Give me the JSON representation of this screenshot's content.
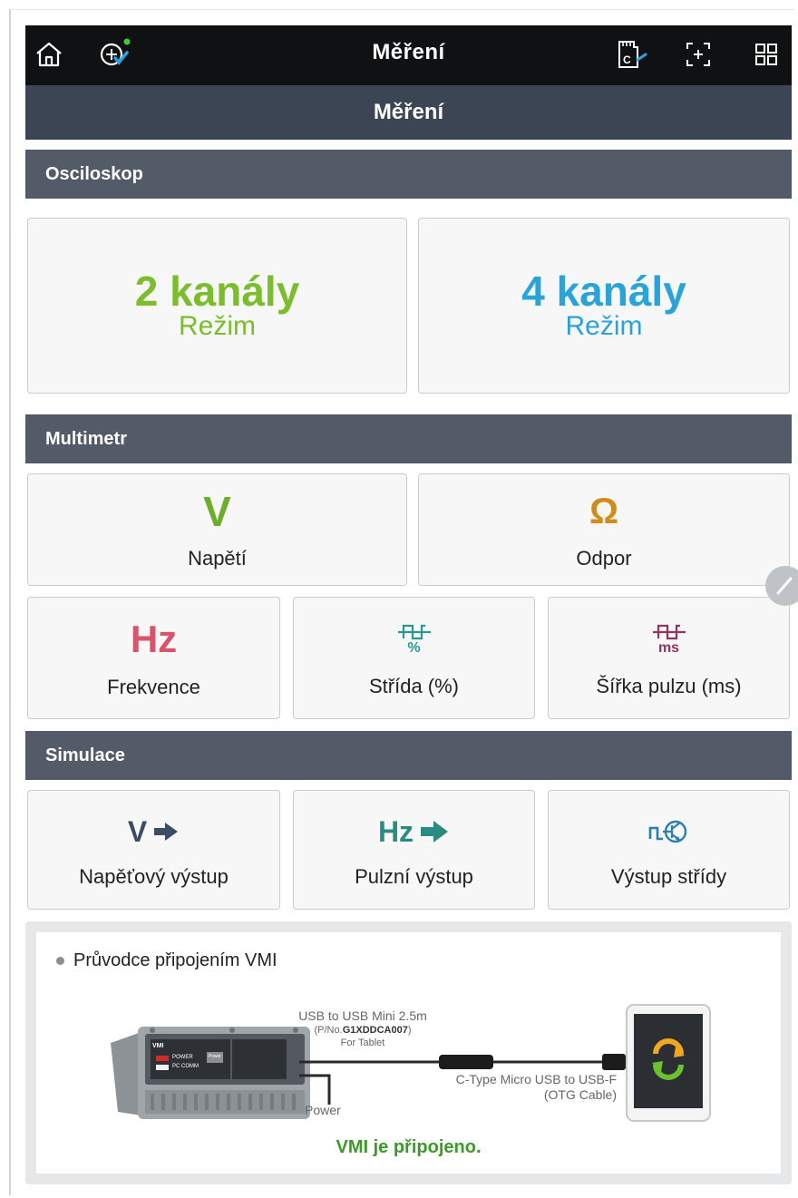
{
  "app": {
    "title": "Měření",
    "subtitle": "Měření"
  },
  "topbar_icons": [
    "home-icon",
    "vci-status-icon",
    "sd-card-icon",
    "screenshot-icon",
    "grid-menu-icon"
  ],
  "sections": {
    "oscilloscope": "Osciloskop",
    "multimeter": "Multimetr",
    "simulation": "Simulace"
  },
  "oscilloscope": {
    "two_channel": {
      "title": "2 kanály",
      "sub": "Režim",
      "color": "#7cbd2d"
    },
    "four_channel": {
      "title": "4 kanály",
      "sub": "Režim",
      "color": "#2aa3d8"
    }
  },
  "multimeter": {
    "voltage": {
      "symbol": "V",
      "label": "Napětí",
      "color": "#6cae2a"
    },
    "resistance": {
      "symbol": "Ω",
      "label": "Odpor",
      "color": "#d08d1c"
    },
    "frequency": {
      "symbol": "Hz",
      "label": "Frekvence",
      "color": "#d9546a"
    },
    "duty": {
      "symbol": "%",
      "label": "Střída (%)",
      "color": "#2a9a8f"
    },
    "pulse_width": {
      "symbol": "ms",
      "label": "Šířka pulzu (ms)",
      "color": "#8e3563"
    }
  },
  "simulation": {
    "voltage_out": {
      "symbol": "V",
      "label": "Napěťový výstup",
      "color": "#3a4d62"
    },
    "pulse_out": {
      "symbol": "Hz",
      "label": "Pulzní výstup",
      "color": "#2a8c80"
    },
    "duty_out": {
      "label": "Výstup střídy",
      "color": "#2a7fae"
    }
  },
  "guide": {
    "title": "Průvodce připojením VMI",
    "cable_top_line1": "USB to USB Mini 2.5m",
    "cable_top_pn_prefix": "(P/No.",
    "cable_top_pn": "G1XDDCA007",
    "cable_top_pn_suffix": ")",
    "cable_top_line3": "For Tablet",
    "power_label": "Power",
    "otg_line1": "C-Type Micro USB to USB-F",
    "otg_line2": "(OTG Cable)",
    "device_brand": "VMI",
    "device_power": "POWER",
    "device_pc": "PC COMM",
    "device_btn": "Power",
    "status": "VMI je připojeno.",
    "status_color": "#3c9a28"
  }
}
